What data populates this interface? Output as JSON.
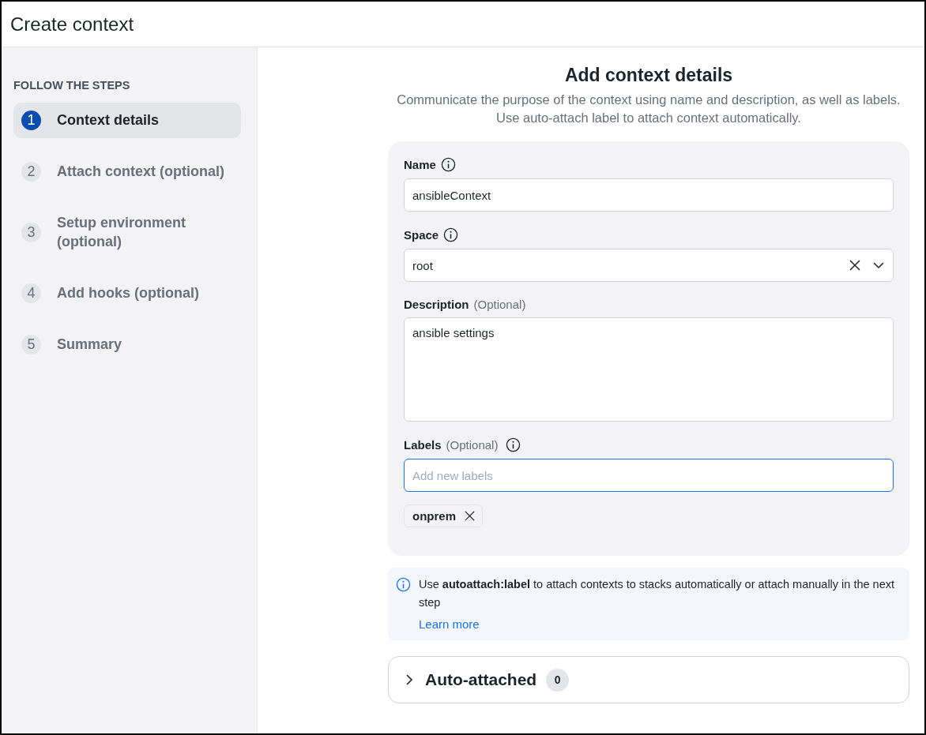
{
  "window": {
    "title": "Create context"
  },
  "sidebar": {
    "heading": "FOLLOW THE STEPS",
    "steps": [
      {
        "number": "1",
        "label": "Context details",
        "selected": true
      },
      {
        "number": "2",
        "label": "Attach context (optional)",
        "selected": false
      },
      {
        "number": "3",
        "label": "Setup environment (optional)",
        "selected": false
      },
      {
        "number": "4",
        "label": "Add hooks (optional)",
        "selected": false
      },
      {
        "number": "5",
        "label": "Summary",
        "selected": false
      }
    ]
  },
  "section": {
    "title": "Add context details",
    "subtitle": "Communicate the purpose of the context using name and description, as well as labels. Use auto-attach label to attach context automatically."
  },
  "form": {
    "name": {
      "label": "Name",
      "value": "ansibleContext"
    },
    "space": {
      "label": "Space",
      "value": "root"
    },
    "description": {
      "label": "Description",
      "optional": "(Optional)",
      "value": "ansible settings"
    },
    "labels": {
      "label": "Labels",
      "optional": "(Optional)",
      "placeholder": "Add new labels",
      "focused": true,
      "tags": [
        "onprem"
      ]
    }
  },
  "info": {
    "text": "Use **autoattach:label** to attach contexts to stacks automatically or attach manually in the next step",
    "link": "Learn more"
  },
  "auto_attached": {
    "title": "Auto-attached",
    "count": "0",
    "expanded": false
  }
}
